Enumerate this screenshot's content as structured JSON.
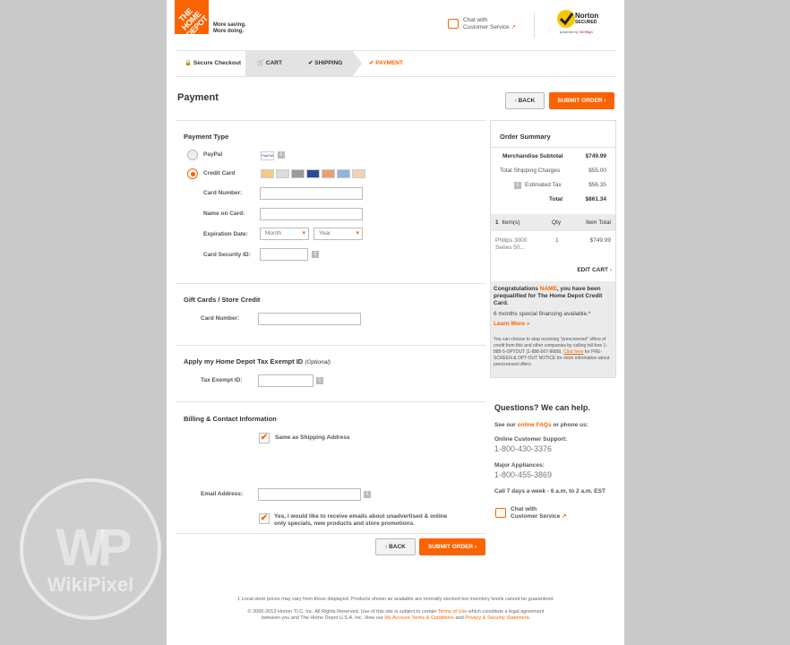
{
  "header": {
    "logo_text": "THE HOME DEPOT",
    "tagline_1": "More saving.",
    "tagline_2": "More doing.",
    "chat_line1": "Chat with",
    "chat_line2": "Customer Service",
    "norton_top": "Norton",
    "norton_secured": "SECURED",
    "norton_powered": "powered by",
    "norton_brand": "VeriSign"
  },
  "steps": {
    "secure": "Secure Checkout",
    "cart": "CART",
    "shipping": "SHIPPING",
    "payment": "PAYMENT"
  },
  "page_title": "Payment",
  "buttons": {
    "back": "BACK",
    "submit": "SUBMIT ORDER"
  },
  "payment_type": {
    "heading": "Payment Type",
    "paypal": "PayPal",
    "paypal_badge": "PayPal",
    "credit_card": "Credit Card",
    "card_number_label": "Card Number:",
    "name_label": "Name on Card:",
    "expiration_label": "Expiration Date:",
    "month": "Month",
    "year": "Year",
    "security_label": "Card Security ID:"
  },
  "gift": {
    "heading": "Gift Cards / Store Credit",
    "card_number_label": "Card Number:"
  },
  "tax": {
    "heading": "Apply my Home Depot Tax Exempt ID",
    "optional": "(Optional)",
    "label": "Tax Exempt ID:"
  },
  "billing": {
    "heading": "Billing & Contact Information",
    "same_as_shipping": "Same as Shipping Address",
    "email_label": "Email Address:",
    "optin_1": "Yes, I would like to receive emails about unadvertised & online",
    "optin_2": "only specials, new products and store promotions."
  },
  "order_summary": {
    "heading": "Order Summary",
    "merch_label": "Merchandise Subtotal",
    "merch_value": "$749.99",
    "shipping_label": "Total Shipping Charges",
    "shipping_value": "$55.00",
    "tax_label": "Estimated Tax",
    "tax_value": "$56.35",
    "total_label": "Total",
    "total_value": "$861.34",
    "col_items_count": "1",
    "col_items": "Item(s)",
    "col_qty": "Qty",
    "col_total": "Item Total",
    "item_name_1": "Philips 3000",
    "item_name_2": "Series 50...",
    "item_qty": "1",
    "item_total": "$749.99",
    "edit_cart": "EDIT CART"
  },
  "promo": {
    "congrats_1": "Congratulations ",
    "congrats_name": "NAME",
    "congrats_2": ", you have been prequalified for The Home Depot Credit Card.",
    "financing": "6 months special financing available.*",
    "learn_more": "Learn More »",
    "fine_1": "You can choose to stop receiving \"prescreened\" offers of credit from this and other companies by calling toll-free 1-888-5-OPTOUT (1-888-567-8688). ",
    "fine_link": "Click here",
    "fine_2": " for PRE-SCREEN & OPT-OUT NOTICE for more information about prescreened offers."
  },
  "help": {
    "heading": "Questions? We can help.",
    "see_our": "See our ",
    "faqs": "online FAQs",
    "or_phone": " or phone us:",
    "online_support_label": "Online Customer Support:",
    "online_support_phone": "1-800-430-3376",
    "appliances_label": "Major Appliances:",
    "appliances_phone": "1-800-455-3869",
    "hours": "Call 7 days a week - 6 a.m. to 2 a.m. EST",
    "chat_line1": "Chat with",
    "chat_line2": "Customer Service"
  },
  "footer": {
    "note": "1 Local store prices may vary from those displayed. Products shown as available are normally stocked but inventory levels cannot be guaranteed.",
    "copyright_1": "© 2000-2013 Homer TLC, Inc. All Rights Reserved. Use of this site is subject to certain ",
    "terms": "Terms of Use",
    "copyright_2": " which constitute a legal agreement",
    "copyright_3": "between you and The Home Depot U.S.A. Inc. View our ",
    "account_terms": "My Account Terms & Conditions",
    "and": " and ",
    "privacy": "Privacy & Security Statement",
    "period": "."
  },
  "watermark": "WikiPixel",
  "colors": {
    "brand_orange": "#f96302",
    "background": "#c9c9c9"
  }
}
